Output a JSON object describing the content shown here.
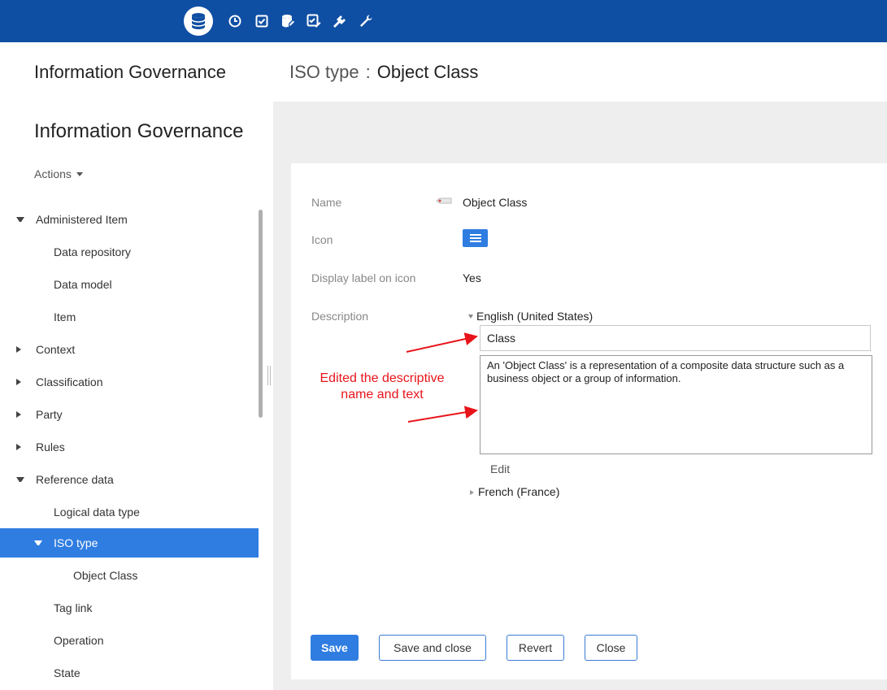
{
  "toolbar": {
    "icons": [
      "database-icon",
      "clock-icon",
      "checkbox-icon",
      "database-edit-icon",
      "checklist-edit-icon",
      "plug-icon",
      "wrench-icon"
    ],
    "active_icon": "database-icon",
    "bar_color": "#0f4fa3"
  },
  "header": {
    "app_title": "Information Governance",
    "breadcrumb_type": "ISO type",
    "breadcrumb_sep": ":",
    "object_title": "Object Class"
  },
  "sidebar": {
    "title": "Information Governance",
    "actions_label": "Actions",
    "items": [
      {
        "label": "Administered Item",
        "state": "expanded"
      },
      {
        "label": "Data repository",
        "state": "leaf"
      },
      {
        "label": "Data model",
        "state": "leaf"
      },
      {
        "label": "Item",
        "state": "leaf"
      },
      {
        "label": "Context",
        "state": "collapsed"
      },
      {
        "label": "Classification",
        "state": "collapsed"
      },
      {
        "label": "Party",
        "state": "collapsed"
      },
      {
        "label": "Rules",
        "state": "collapsed"
      },
      {
        "label": "Reference data",
        "state": "expanded"
      },
      {
        "label": "Logical data type",
        "state": "leaf"
      },
      {
        "label": "ISO type",
        "state": "expanded",
        "selected": true
      },
      {
        "label": "Object Class",
        "state": "leaf"
      },
      {
        "label": "Tag link",
        "state": "leaf"
      },
      {
        "label": "Operation",
        "state": "leaf"
      },
      {
        "label": "State",
        "state": "leaf"
      }
    ],
    "selected_color": "#2f7de1"
  },
  "form": {
    "name_label": "Name",
    "name_value": "Object Class",
    "icon_label": "Icon",
    "icon_color": "#2f7de1",
    "display_label": "Display label on icon",
    "display_value": "Yes",
    "description_label": "Description",
    "lang_en": "English (United States)",
    "desc_name_value": "Class",
    "desc_text_value": "An 'Object Class' is a representation of a composite data structure such as a business object or a group of information.",
    "edit_link": "Edit",
    "lang_fr": "French (France)"
  },
  "annotation": {
    "line1": "Edited the descriptive",
    "line2": "name and text",
    "color": "#e8141b"
  },
  "buttons": {
    "save": "Save",
    "save_close": "Save and close",
    "revert": "Revert",
    "close": "Close"
  }
}
